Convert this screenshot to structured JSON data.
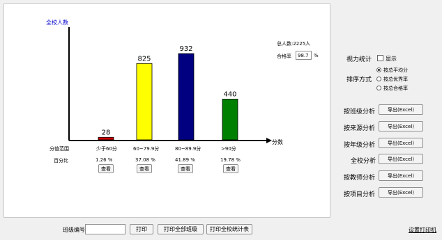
{
  "chart_data": {
    "type": "bar",
    "ylabel": "全校人数",
    "xlabel": "分数",
    "categories": [
      "少于60分",
      "60~79.9分",
      "80~89.9分",
      ">90分"
    ],
    "values": [
      28,
      825,
      932,
      440
    ],
    "percentages": [
      "1.26 %",
      "37.08 %",
      "41.89 %",
      "19.78 %"
    ],
    "colors": [
      "#cc0000",
      "#ffff00",
      "#000080",
      "#008000"
    ],
    "ylim": [
      0,
      1100
    ]
  },
  "stats": {
    "total_label": "总人数:2225人",
    "pass_rate_label": "合格率",
    "pass_rate_value": "98.7",
    "pass_rate_unit": "%"
  },
  "table": {
    "range_label": "分值范围",
    "percent_label": "百分比",
    "view_label": "查看"
  },
  "right_panel": {
    "vision_label": "视力统计",
    "show_label": "显示",
    "sort_label": "排序方式",
    "sort_options": [
      "按总平均分",
      "按总优秀率",
      "按总合格率"
    ],
    "export_label": "导出(Excel)",
    "analyses": [
      "按班级分析",
      "按来源分析",
      "按年级分析",
      "全校分析",
      "按教师分析",
      "按项目分析"
    ],
    "printer_label": "设置打印机"
  },
  "bottom": {
    "class_no_label": "班级编号",
    "class_no_value": "",
    "print_label": "打印",
    "print_all_label": "打印全部班级",
    "print_stats_label": "打印全校统计表"
  }
}
